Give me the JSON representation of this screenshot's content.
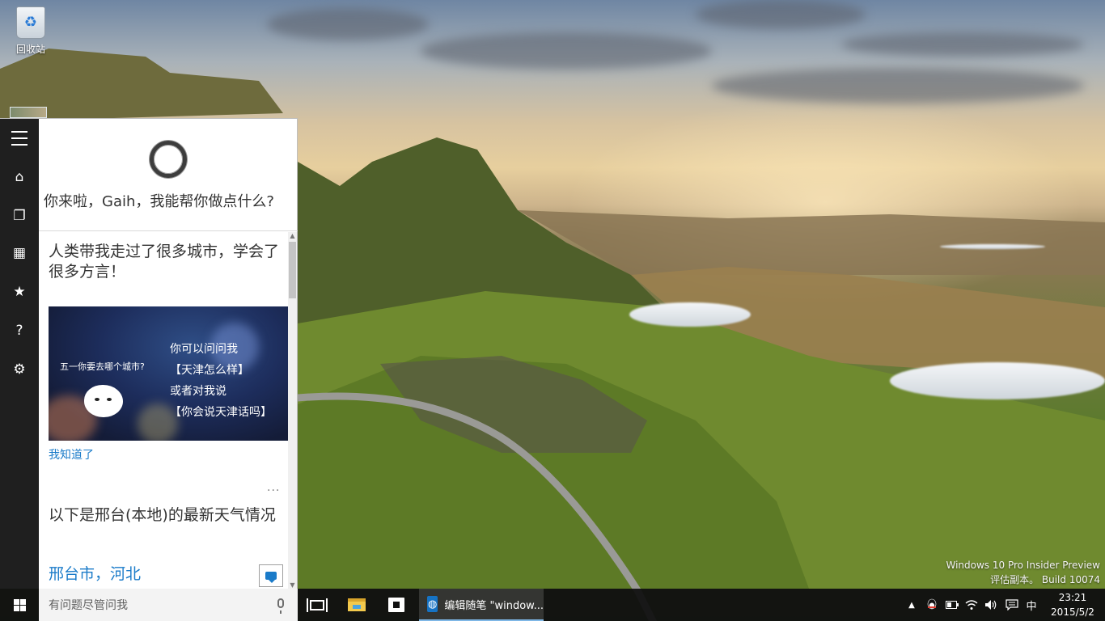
{
  "desktop": {
    "recycle_bin_label": "回收站",
    "watermark_line1": "Windows 10 Pro Insider Preview",
    "watermark_line2": "评估副本。 Build 10074"
  },
  "cortana": {
    "greeting": "你来啦，Gaih，我能帮你做点什么?",
    "card_title": "人类带我走过了很多城市，学会了很多方言！",
    "promo": {
      "question": "五一你要去哪个城市?",
      "line1": "你可以问问我",
      "line2": "【天津怎么样】",
      "line3": "或者对我说",
      "line4": "【你会说天津话吗】"
    },
    "got_it_link": "我知道了",
    "more_options": "···",
    "weather_title": "以下是邢台(本地)的最新天气情况",
    "city_label": "邢台市，河北",
    "rail_icons": [
      "menu-icon",
      "home-icon",
      "notebook-icon",
      "calendar-icon",
      "star-icon",
      "help-icon",
      "settings-icon"
    ]
  },
  "taskbar": {
    "search_placeholder": "有问题尽管问我",
    "active_app_label": "编辑随笔 \"window...",
    "ime_label": "中",
    "time": "23:21",
    "date": "2015/5/2",
    "accent_color": "#1673c4"
  }
}
